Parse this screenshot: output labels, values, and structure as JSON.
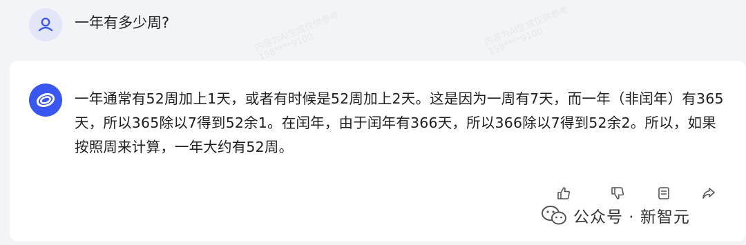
{
  "user": {
    "question": "一年有多少周?"
  },
  "assistant": {
    "answer": "一年通常有52周加上1天，或者有时候是52周加上2天。这是因为一周有7天，而一年（非闰年）有365天，所以365除以7得到52余1。在闰年，由于闰年有366天，所以366除以7得到52余2。所以，如果按照周来计算，一年大约有52周。"
  },
  "watermark": {
    "line1": "内容为AI生成仅供参考",
    "line2": "158****9100"
  },
  "actions": {
    "icons": [
      "thumbs-up-icon",
      "thumbs-down-icon",
      "copy-icon",
      "share-icon"
    ]
  },
  "brand": {
    "label": "公众号 · 新智元",
    "icon": "wechat-icon"
  },
  "colors": {
    "background": "#f3f4f8",
    "card": "#ffffff",
    "accent": "#3a56f0"
  }
}
